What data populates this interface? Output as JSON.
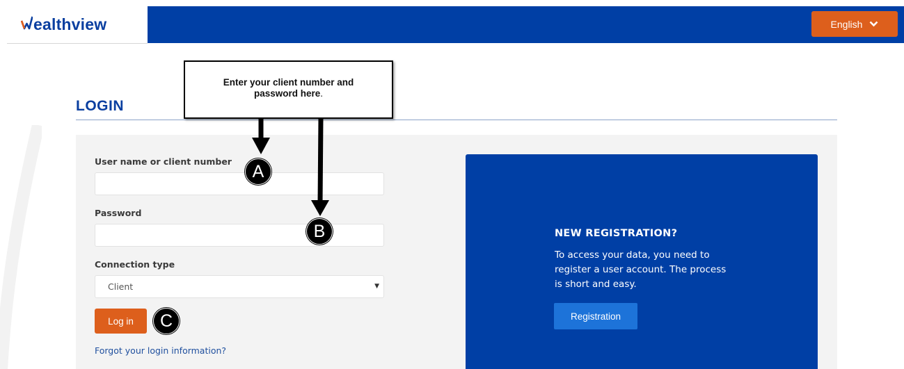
{
  "header": {
    "brand": "ealthview",
    "language_label": "English"
  },
  "login": {
    "title": "LOGIN",
    "username_label": "User name or client number",
    "username_value": "",
    "password_label": "Password",
    "password_value": "",
    "connection_label": "Connection type",
    "connection_selected": "Client",
    "login_button": "Log in",
    "forgot_link": "Forgot your login information?"
  },
  "registration": {
    "title": "NEW REGISTRATION?",
    "description": "To access your data, you need to register a user account. The process is short and easy.",
    "button": "Registration"
  },
  "annotations": {
    "callout_line1": "Enter your client number and",
    "callout_line2": "password here",
    "callout_period": ".",
    "marker_a": "A",
    "marker_b": "B",
    "marker_c": "C"
  },
  "colors": {
    "brand_blue": "#003fa5",
    "accent_orange": "#dd5f1c",
    "registration_button": "#1d73d9"
  }
}
